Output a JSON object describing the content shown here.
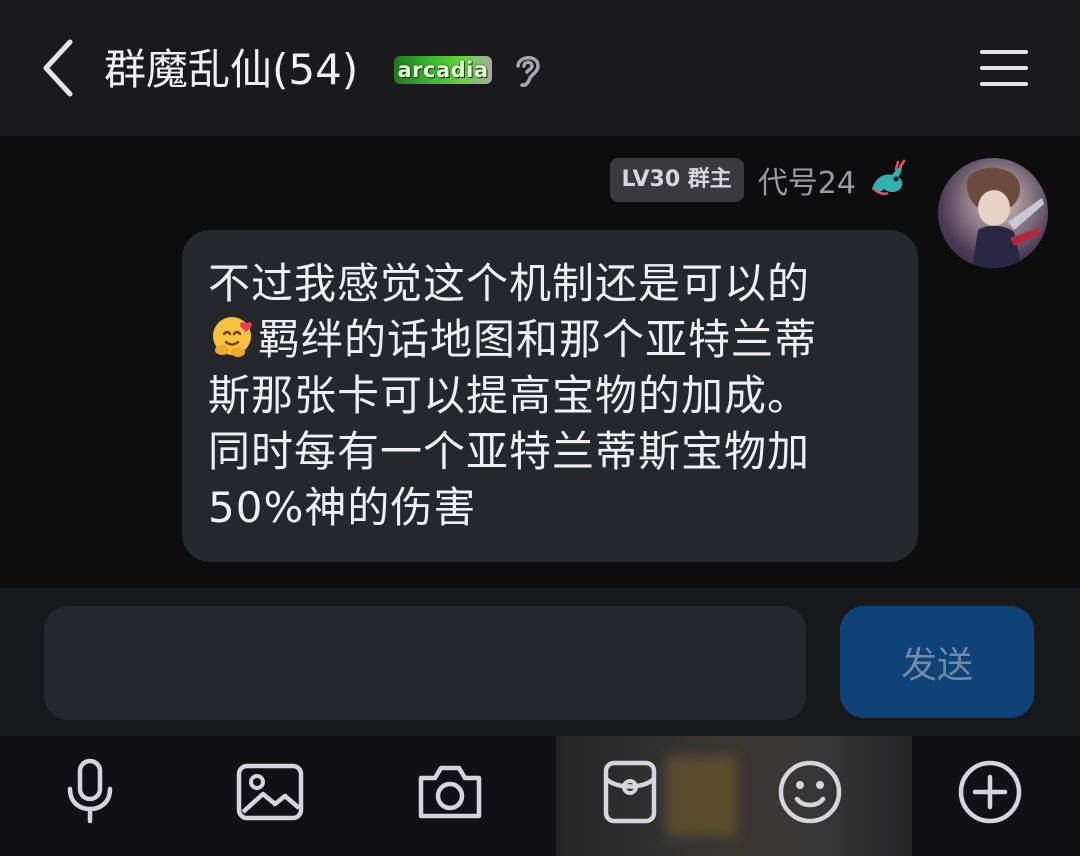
{
  "header": {
    "title": "群魔乱仙",
    "member_count": "(54)",
    "badge_text": "arcadia",
    "icons": {
      "back": "chevron-left-icon",
      "ear": "ear-icon",
      "menu": "hamburger-menu-icon"
    }
  },
  "message": {
    "level_badge": "LV30 群主",
    "sender": "代号24",
    "lines": [
      "不过我感觉这个机制还是可以的",
      "羁绊的话地图和那个亚特兰蒂",
      "斯那张卡可以提高宝物的加成。",
      "同时每有一个亚特兰蒂斯宝物加",
      "50%神的伤害"
    ],
    "emoji": "hugging-face-emoji"
  },
  "input": {
    "value": "",
    "placeholder": "",
    "send_label": "发送"
  },
  "toolbar": {
    "items": [
      "microphone-icon",
      "image-icon",
      "camera-icon",
      "red-packet-icon",
      "emoji-icon",
      "plus-icon"
    ]
  },
  "colors": {
    "header_bg": "#1a1a1c",
    "chat_bg": "#0d0d0e",
    "bubble_bg": "#26272a",
    "send_btn_bg": "#0f4377",
    "badge_green": "#3bbd32"
  }
}
